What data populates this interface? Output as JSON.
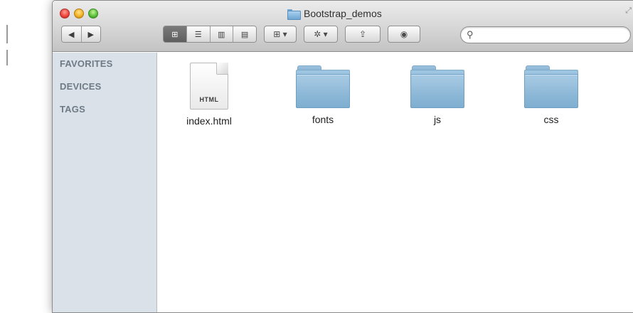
{
  "window": {
    "title": "Bootstrap_demos",
    "title_icon": "folder-icon",
    "traffic_lights": [
      "close-button",
      "minimize-button",
      "zoom-button"
    ],
    "resize_icon": "fullscreen-icon"
  },
  "toolbar": {
    "back_glyph": "◀",
    "forward_glyph": "▶",
    "view_modes": [
      {
        "name": "icon-view",
        "glyph": "⊞",
        "active": true
      },
      {
        "name": "list-view",
        "glyph": "☰",
        "active": false
      },
      {
        "name": "column-view",
        "glyph": "▥",
        "active": false
      },
      {
        "name": "coverflow-view",
        "glyph": "▤",
        "active": false
      }
    ],
    "arrange_glyph": "⊞ ▾",
    "action_glyph": "✲ ▾",
    "share_glyph": "⇪",
    "tag_glyph": "◉",
    "search": {
      "value": "",
      "placeholder": "",
      "icon_glyph": "⚲"
    }
  },
  "sidebar": {
    "headings": [
      "FAVORITES",
      "DEVICES",
      "TAGS"
    ]
  },
  "files": [
    {
      "name": "index.html",
      "kind": "document",
      "label": "HTML"
    },
    {
      "name": "fonts",
      "kind": "folder"
    },
    {
      "name": "js",
      "kind": "folder"
    },
    {
      "name": "css",
      "kind": "folder"
    }
  ],
  "colors": {
    "sidebar_bg": "#dbe1e8",
    "sidebar_heading": "#6e7a86",
    "folder_blue": "#8db8d7"
  }
}
